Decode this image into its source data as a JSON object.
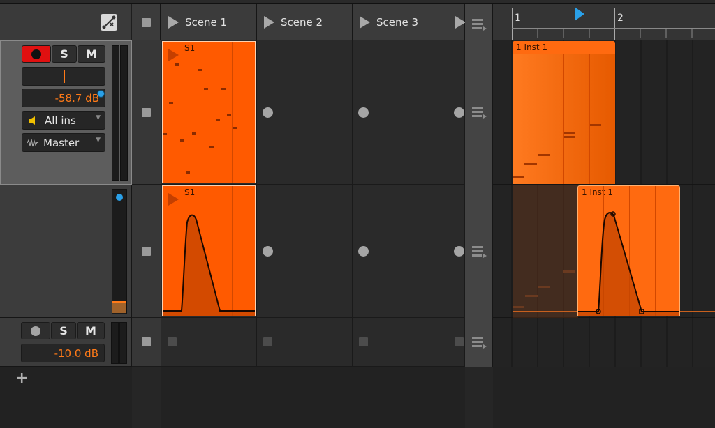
{
  "scenes": [
    {
      "label": "Scene 1"
    },
    {
      "label": "Scene 2"
    },
    {
      "label": "Scene 3"
    }
  ],
  "ruler": {
    "bar1": "1",
    "bar2": "2"
  },
  "track1": {
    "solo": "S",
    "mute": "M",
    "volume": "-58.7 dB",
    "input": "All ins",
    "output": "Master",
    "clip_name": "S1"
  },
  "track2": {
    "clip_name": "S1"
  },
  "track3": {
    "solo": "S",
    "mute": "M",
    "volume": "-10.0 dB"
  },
  "arranger": {
    "clip1": "1  Inst 1",
    "clip2": "1  Inst 1"
  },
  "add_track": "+",
  "colors": {
    "accent": "#ff5a00",
    "record": "#e01010",
    "play_marker": "#2aa0e8"
  }
}
